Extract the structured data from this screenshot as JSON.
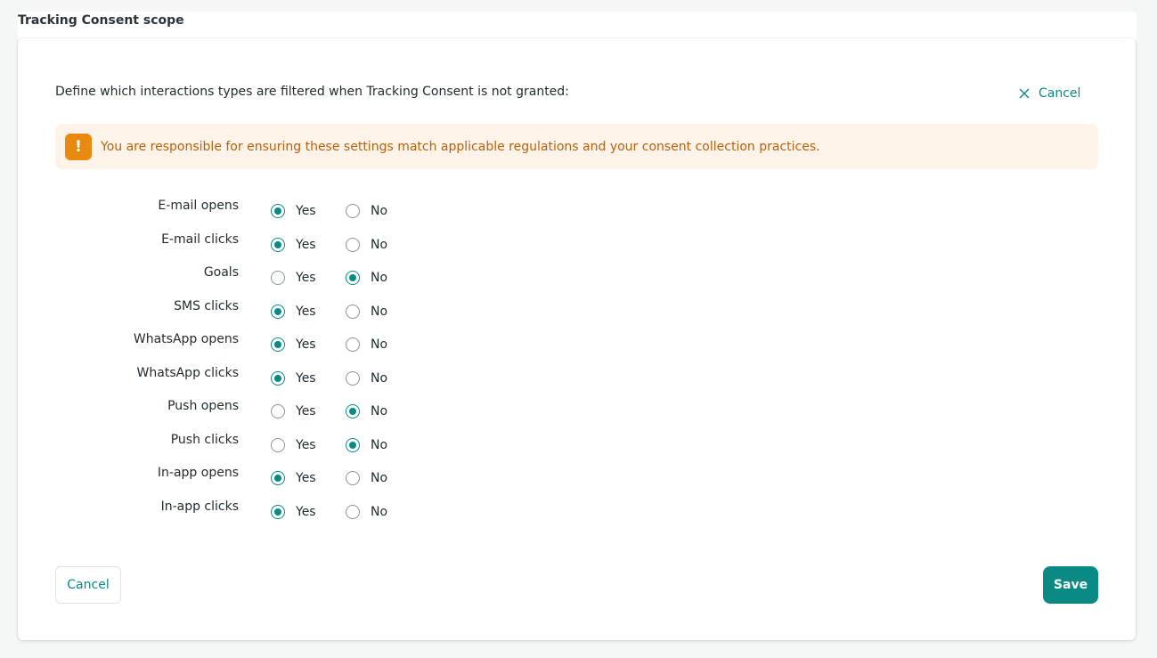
{
  "section": {
    "title": "Tracking Consent scope"
  },
  "card": {
    "intro": "Define which interactions types are filtered when Tracking Consent is not granted:",
    "top_cancel_label": "Cancel",
    "warning": "You are responsible for ensuring these settings match applicable regulations and your consent collection practices.",
    "warning_icon_glyph": "!",
    "yes_label": "Yes",
    "no_label": "No",
    "rows": [
      {
        "label": "E-mail opens",
        "value": "yes"
      },
      {
        "label": "E-mail clicks",
        "value": "yes"
      },
      {
        "label": "Goals",
        "value": "no"
      },
      {
        "label": "SMS clicks",
        "value": "yes"
      },
      {
        "label": "WhatsApp opens",
        "value": "yes"
      },
      {
        "label": "WhatsApp clicks",
        "value": "yes"
      },
      {
        "label": "Push opens",
        "value": "no"
      },
      {
        "label": "Push clicks",
        "value": "no"
      },
      {
        "label": "In-app opens",
        "value": "yes"
      },
      {
        "label": "In-app clicks",
        "value": "yes"
      }
    ],
    "cancel_button": "Cancel",
    "save_button": "Save"
  },
  "colors": {
    "accent": "#0b8a85",
    "warning_bg": "#fdf3e8",
    "warning_text": "#b8620c",
    "warning_icon": "#e88a12"
  }
}
